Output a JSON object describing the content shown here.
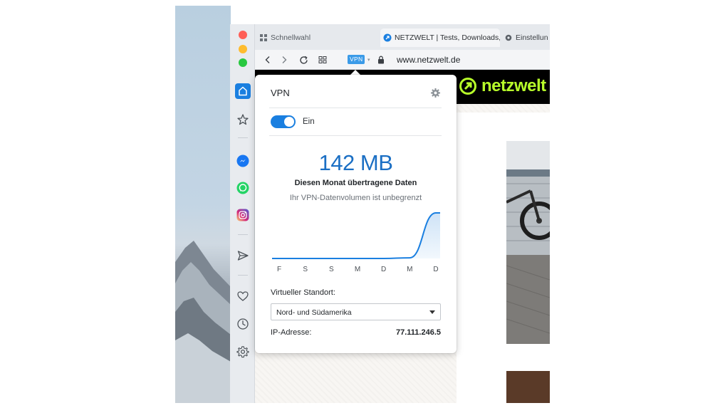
{
  "window": {
    "tabs": [
      {
        "label": "Schnellwahl",
        "icon": "grid-icon"
      },
      {
        "label": "NETZWELT | Tests, Downloads,",
        "icon": "netzwelt-favicon"
      },
      {
        "label": "Einstellun",
        "icon": "gear-icon"
      }
    ],
    "toolbar": {
      "vpn_badge": "VPN",
      "url": "www.netzwelt.de"
    }
  },
  "page": {
    "logo_text": "netzwelt"
  },
  "vpn_popup": {
    "title": "VPN",
    "toggle_label": "Ein",
    "toggle_on": true,
    "data_amount": "142 MB",
    "data_description": "Diesen Monat übertragene Daten",
    "data_subtext": "Ihr VPN-Datenvolumen ist unbegrenzt",
    "location_label": "Virtueller Standort:",
    "location_value": "Nord- und Südamerika",
    "ip_label": "IP-Adresse:",
    "ip_value": "77.111.246.5"
  },
  "chart_data": {
    "type": "area",
    "categories": [
      "F",
      "S",
      "S",
      "M",
      "D",
      "M",
      "D"
    ],
    "values": [
      0,
      0,
      0,
      0,
      0,
      2,
      142
    ]
  },
  "colors": {
    "accent": "#1a7fe0",
    "logo": "#b8ff2a"
  }
}
